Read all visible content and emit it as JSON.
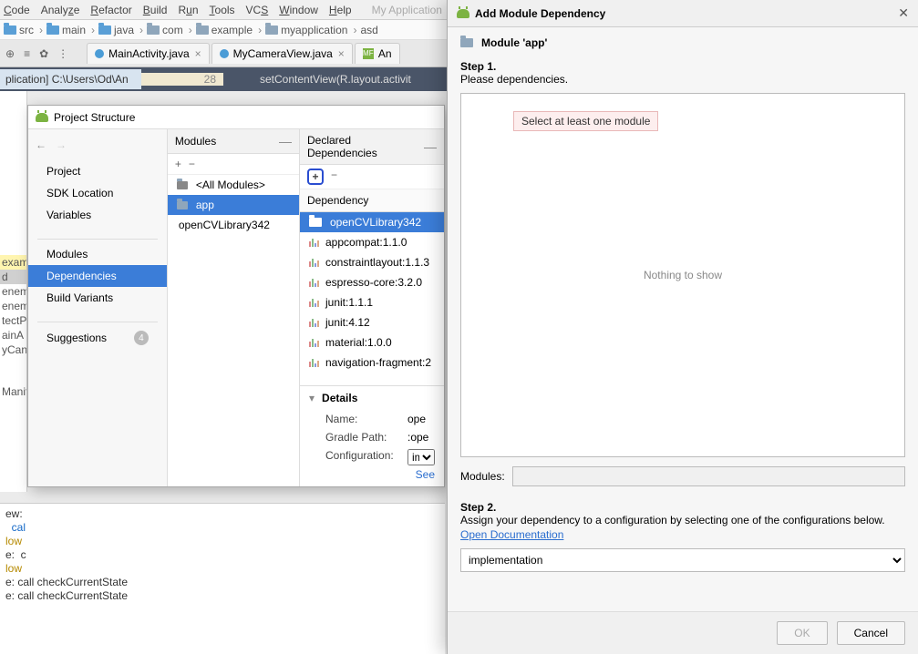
{
  "menu": {
    "items": [
      "Code",
      "Analyze",
      "Refactor",
      "Build",
      "Run",
      "Tools",
      "VCS",
      "Window",
      "Help"
    ],
    "project": "My Application"
  },
  "breadcrumbs": [
    "src",
    "main",
    "java",
    "com",
    "example",
    "myapplication",
    "asd"
  ],
  "toolbar_icons": [
    "⊕",
    "≡",
    "✿",
    "⋮"
  ],
  "tabs": [
    {
      "label": "MainActivity.java",
      "color": "#4b9cd6"
    },
    {
      "label": "MyCameraView.java",
      "color": "#4b9cd6"
    },
    {
      "label": "An",
      "color": "#7cb342"
    }
  ],
  "editor": {
    "left": "plication]  C:\\Users\\Od\\An",
    "linenum": "28",
    "code": "setContentView(R.layout.activit"
  },
  "left_gutter": [
    "exam",
    "d",
    "enem",
    "enem",
    "tectP",
    "ainA",
    "yCan",
    "",
    "",
    "Manif",
    "",
    "",
    "",
    "ew:",
    "  cal",
    "low",
    "e:  c",
    "low",
    "e: call checkCurrentState",
    "e: call checkCurrentState"
  ],
  "ps": {
    "title": "Project Structure",
    "nav_back": "←",
    "nav_fwd": "→",
    "nav": [
      "Project",
      "SDK Location",
      "Variables"
    ],
    "nav2": [
      "Modules",
      "Dependencies",
      "Build Variants"
    ],
    "nav2_selected": "Dependencies",
    "nav3": {
      "label": "Suggestions",
      "badge": "4"
    },
    "mods_header": "Modules",
    "mods_minus": "—",
    "mods_tools": [
      "+",
      "−"
    ],
    "mods": [
      "<All Modules>",
      "app",
      "openCVLibrary342"
    ],
    "mods_selected": "app",
    "deps_header": "Declared Dependencies",
    "deps_minus": "—",
    "deps_add": "+",
    "deps_remove": "−",
    "dep_col": "Dependency",
    "deps": [
      "openCVLibrary342",
      "appcompat:1.1.0",
      "constraintlayout:1.1.3",
      "espresso-core:3.2.0",
      "junit:1.1.1",
      "junit:4.12",
      "material:1.0.0",
      "navigation-fragment:2"
    ],
    "deps_selected": "openCVLibrary342",
    "details": {
      "hd": "Details",
      "name_lbl": "Name:",
      "name": "ope",
      "path_lbl": "Gradle Path:",
      "path": ":ope",
      "config_lbl": "Configuration:",
      "config": "im",
      "link": "See"
    }
  },
  "amd": {
    "title": "Add Module Dependency",
    "close": "✕",
    "module_label": "Module 'app'",
    "step1": "Step 1.",
    "please": "Please                                                                        dependencies.",
    "tooltip": "Select at least one module",
    "nothing": "Nothing to show",
    "modules_lbl": "Modules:",
    "modules_val": "",
    "step2": "Step 2.",
    "step2_text": "Assign your dependency to a configuration by selecting one of the configurations below.",
    "doc_link": "Open Documentation",
    "combo": "implementation",
    "ok": "OK",
    "cancel": "Cancel"
  },
  "console_lines": [
    {
      "t": "ew:",
      "c": ""
    },
    {
      "t": "  cal",
      "c": "bl"
    },
    {
      "t": "low",
      "c": "yl"
    },
    {
      "t": "e:  c",
      "c": ""
    },
    {
      "t": "low ",
      "c": "yl"
    },
    {
      "t": "e: call checkCurrentState",
      "c": ""
    },
    {
      "t": "e: call checkCurrentState",
      "c": ""
    }
  ]
}
